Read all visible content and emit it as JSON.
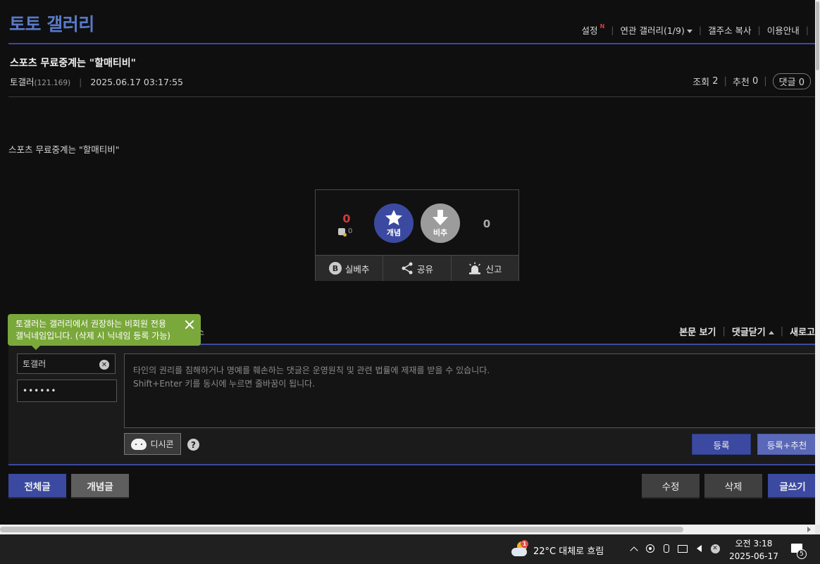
{
  "header": {
    "gallery_title": "토토 갤러리",
    "links": {
      "settings": "설정",
      "new_badge": "N",
      "related": "연관 갤러리(1/9)",
      "copy_address": "갤주소 복사",
      "guide": "이용안내"
    }
  },
  "post": {
    "title": "스포츠 무료중계는 \"할매티비\"",
    "author": "토갤러",
    "author_ip": "(121.169)",
    "datetime": "2025.06.17 03:17:55",
    "views_label": "조회",
    "views": "2",
    "recommend_label": "추천",
    "recommend": "0",
    "comments_label": "댓글",
    "comments": "0",
    "content": "스포츠 무료중계는 \"할매티비\""
  },
  "vote": {
    "up_count": "0",
    "fixed_count": "0",
    "up_label": "개념",
    "down_label": "비추",
    "down_count": "0",
    "real_down": "실베추",
    "real_down_badge": "B",
    "share": "공유",
    "report": "신고"
  },
  "comment_section": {
    "ghost_label": "소",
    "view_content": "본문 보기",
    "close_comments": "댓글닫기",
    "refresh": "새로고"
  },
  "tooltip": {
    "line1": "토갤러는 갤러리에서 권장하는 비회원 전용",
    "line2": "갤닉네임입니다. (삭제 시 닉네임 등록 가능)"
  },
  "comment_form": {
    "name_value": "토갤러",
    "password_value": "••••••",
    "textarea_line1": "타인의 권리를 침해하거나 명예를 훼손하는 댓글은 운영원칙 및 관련 법률에 제재를 받을 수 있습니다.",
    "textarea_line2": "Shift+Enter 키를 동시에 누르면 줄바꿈이 됩니다.",
    "dccon": "디시콘",
    "help": "?",
    "submit": "등록",
    "submit_recommend": "등록+추천"
  },
  "bottom_buttons": {
    "all_posts": "전체글",
    "concept_posts": "개념글",
    "edit": "수정",
    "delete": "삭제",
    "write": "글쓰기"
  },
  "taskbar": {
    "weather_badge": "1",
    "weather_text": "22°C  대체로 흐림",
    "time": "오전 3:18",
    "date": "2025-06-17",
    "notification_count": "5"
  },
  "colors": {
    "accent": "#3b4aa0",
    "title_blue": "#5a7ac8",
    "upvote_red": "#d23a3a",
    "tooltip_green": "#7aa83b"
  }
}
